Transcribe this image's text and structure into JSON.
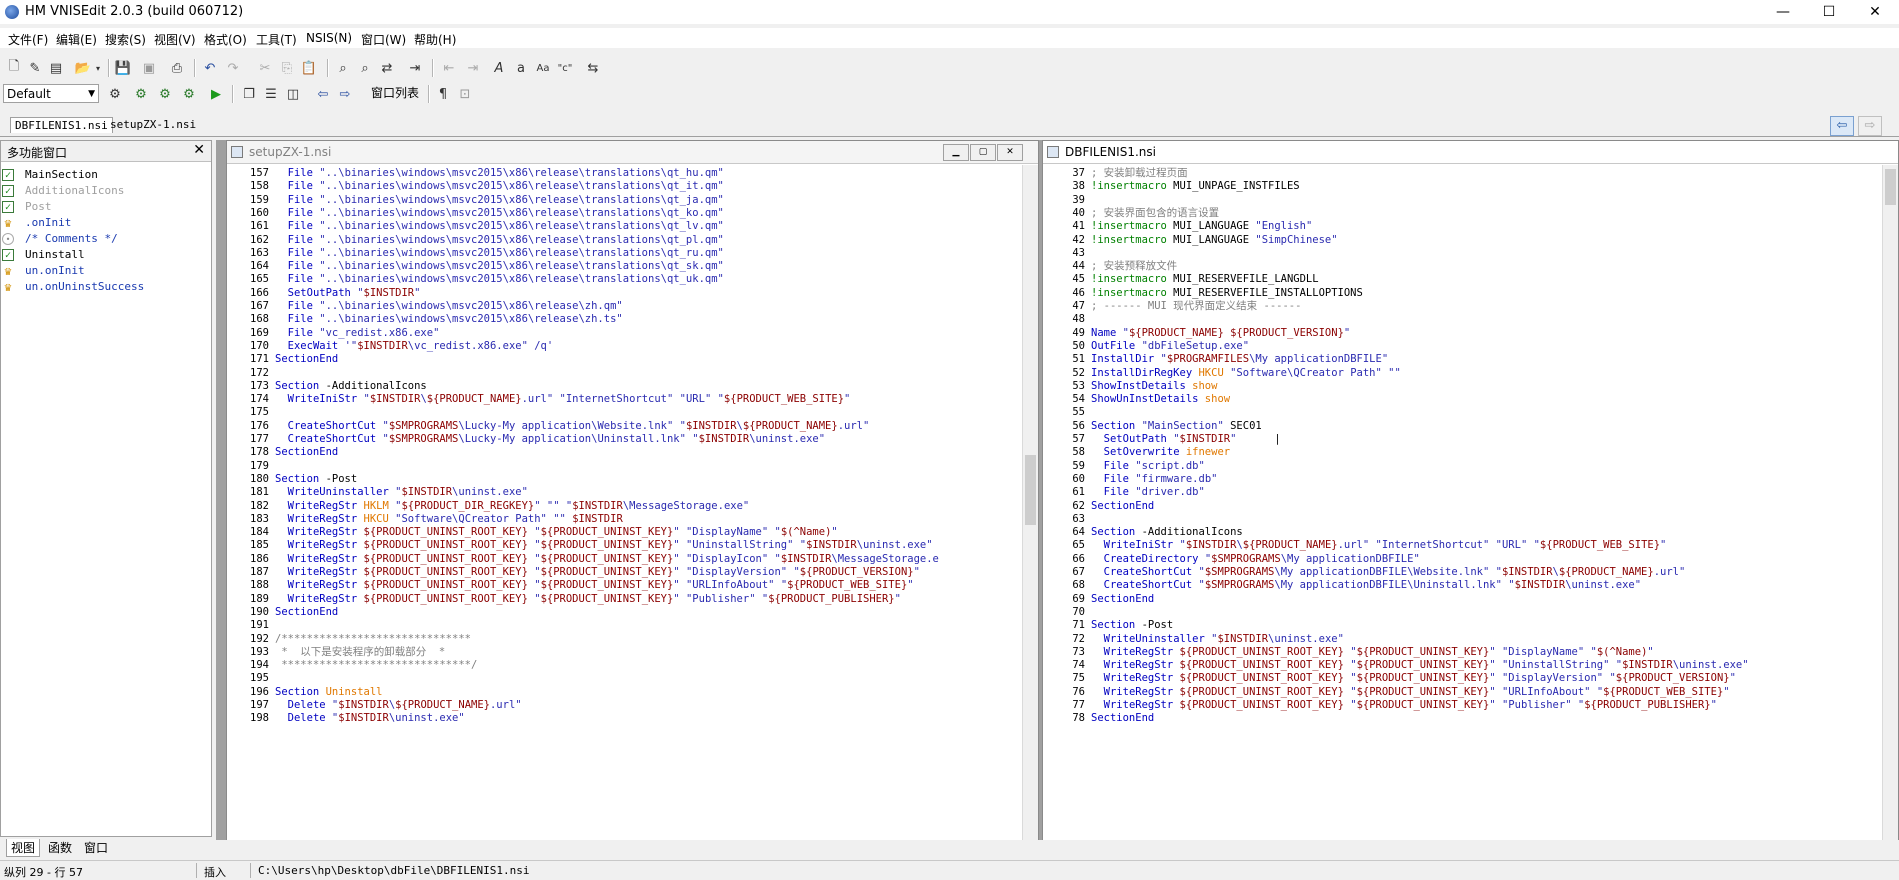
{
  "window": {
    "title": "HM VNISEdit 2.0.3 (build 060712)",
    "minimize": "—",
    "maximize": "☐",
    "close": "✕"
  },
  "menu": [
    "文件(F)",
    "编辑(E)",
    "搜索(S)",
    "视图(V)",
    "格式(O)",
    "工具(T)",
    "NSIS(N)",
    "窗口(W)",
    "帮助(H)"
  ],
  "toolbar2": {
    "combo_value": "Default",
    "window_list": "窗口列表"
  },
  "doc_tabs": [
    "DBFILENIS1.nsi",
    "setupZX-1.nsi"
  ],
  "side_panel": {
    "title": "多功能窗口",
    "items": [
      {
        "label": "MainSection",
        "icon": "checkbox-checked-icon"
      },
      {
        "label": "AdditionalIcons",
        "icon": "checkbox-checked-dim-icon"
      },
      {
        "label": "Post",
        "icon": "checkbox-checked-dim-icon"
      },
      {
        "label": ".onInit",
        "icon": "function-icon"
      },
      {
        "label": "/* Comments */",
        "icon": "comment-icon"
      },
      {
        "label": "Uninstall",
        "icon": "checkbox-checked-icon"
      },
      {
        "label": "un.onInit",
        "icon": "function-icon"
      },
      {
        "label": "un.onUninstSuccess",
        "icon": "function-icon"
      }
    ],
    "tabs": [
      "视图",
      "函数",
      "窗口"
    ]
  },
  "editor_left": {
    "title": "setupZX-1.nsi",
    "lines": [
      {
        "n": "157",
        "t": "  File \"..\\binaries\\windows\\msvc2015\\x86\\release\\translations\\qt_hu.qm\""
      },
      {
        "n": "158",
        "t": "  File \"..\\binaries\\windows\\msvc2015\\x86\\release\\translations\\qt_it.qm\""
      },
      {
        "n": "159",
        "t": "  File \"..\\binaries\\windows\\msvc2015\\x86\\release\\translations\\qt_ja.qm\""
      },
      {
        "n": "160",
        "t": "  File \"..\\binaries\\windows\\msvc2015\\x86\\release\\translations\\qt_ko.qm\""
      },
      {
        "n": "161",
        "t": "  File \"..\\binaries\\windows\\msvc2015\\x86\\release\\translations\\qt_lv.qm\""
      },
      {
        "n": "162",
        "t": "  File \"..\\binaries\\windows\\msvc2015\\x86\\release\\translations\\qt_pl.qm\""
      },
      {
        "n": "163",
        "t": "  File \"..\\binaries\\windows\\msvc2015\\x86\\release\\translations\\qt_ru.qm\""
      },
      {
        "n": "164",
        "t": "  File \"..\\binaries\\windows\\msvc2015\\x86\\release\\translations\\qt_sk.qm\""
      },
      {
        "n": "165",
        "t": "  File \"..\\binaries\\windows\\msvc2015\\x86\\release\\translations\\qt_uk.qm\""
      },
      {
        "n": "166",
        "t": "  SetOutPath \"$INSTDIR\""
      },
      {
        "n": "167",
        "t": "  File \"..\\binaries\\windows\\msvc2015\\x86\\release\\zh.qm\""
      },
      {
        "n": "168",
        "t": "  File \"..\\binaries\\windows\\msvc2015\\x86\\release\\zh.ts\""
      },
      {
        "n": "169",
        "t": "  File \"vc_redist.x86.exe\""
      },
      {
        "n": "170",
        "t": "  ExecWait '\"$INSTDIR\\vc_redist.x86.exe\" /q'"
      },
      {
        "n": "171",
        "t": "SectionEnd"
      },
      {
        "n": "172",
        "t": ""
      },
      {
        "n": "173",
        "t": "Section -AdditionalIcons"
      },
      {
        "n": "174",
        "t": "  WriteIniStr \"$INSTDIR\\${PRODUCT_NAME}.url\" \"InternetShortcut\" \"URL\" \"${PRODUCT_WEB_SITE}\""
      },
      {
        "n": "175",
        "t": "  "
      },
      {
        "n": "176",
        "t": "  CreateShortCut \"$SMPROGRAMS\\Lucky-My application\\Website.lnk\" \"$INSTDIR\\${PRODUCT_NAME}.url\""
      },
      {
        "n": "177",
        "t": "  CreateShortCut \"$SMPROGRAMS\\Lucky-My application\\Uninstall.lnk\" \"$INSTDIR\\uninst.exe\""
      },
      {
        "n": "178",
        "t": "SectionEnd"
      },
      {
        "n": "179",
        "t": ""
      },
      {
        "n": "180",
        "t": "Section -Post"
      },
      {
        "n": "181",
        "t": "  WriteUninstaller \"$INSTDIR\\uninst.exe\""
      },
      {
        "n": "182",
        "t": "  WriteRegStr HKLM \"${PRODUCT_DIR_REGKEY}\" \"\" \"$INSTDIR\\MessageStorage.exe\""
      },
      {
        "n": "183",
        "t": "  WriteRegStr HKCU \"Software\\QCreator Path\" \"\" $INSTDIR"
      },
      {
        "n": "184",
        "t": "  WriteRegStr ${PRODUCT_UNINST_ROOT_KEY} \"${PRODUCT_UNINST_KEY}\" \"DisplayName\" \"$(^Name)\""
      },
      {
        "n": "185",
        "t": "  WriteRegStr ${PRODUCT_UNINST_ROOT_KEY} \"${PRODUCT_UNINST_KEY}\" \"UninstallString\" \"$INSTDIR\\uninst.exe\""
      },
      {
        "n": "186",
        "t": "  WriteRegStr ${PRODUCT_UNINST_ROOT_KEY} \"${PRODUCT_UNINST_KEY}\" \"DisplayIcon\" \"$INSTDIR\\MessageStorage.e"
      },
      {
        "n": "187",
        "t": "  WriteRegStr ${PRODUCT_UNINST_ROOT_KEY} \"${PRODUCT_UNINST_KEY}\" \"DisplayVersion\" \"${PRODUCT_VERSION}\""
      },
      {
        "n": "188",
        "t": "  WriteRegStr ${PRODUCT_UNINST_ROOT_KEY} \"${PRODUCT_UNINST_KEY}\" \"URLInfoAbout\" \"${PRODUCT_WEB_SITE}\""
      },
      {
        "n": "189",
        "t": "  WriteRegStr ${PRODUCT_UNINST_ROOT_KEY} \"${PRODUCT_UNINST_KEY}\" \"Publisher\" \"${PRODUCT_PUBLISHER}\""
      },
      {
        "n": "190",
        "t": "SectionEnd"
      },
      {
        "n": "191",
        "t": ""
      },
      {
        "n": "192",
        "t": "/******************************"
      },
      {
        "n": "193",
        "t": " *  以下是安装程序的卸载部分  *"
      },
      {
        "n": "194",
        "t": " ******************************/"
      },
      {
        "n": "195",
        "t": ""
      },
      {
        "n": "196",
        "t": "Section Uninstall"
      },
      {
        "n": "197",
        "t": "  Delete \"$INSTDIR\\${PRODUCT_NAME}.url\""
      },
      {
        "n": "198",
        "t": "  Delete \"$INSTDIR\\uninst.exe\""
      }
    ]
  },
  "editor_right": {
    "title": "DBFILENIS1.nsi",
    "lines": [
      {
        "n": "37",
        "t": "; 安装卸载过程页面"
      },
      {
        "n": "38",
        "t": "!insertmacro MUI_UNPAGE_INSTFILES"
      },
      {
        "n": "39",
        "t": ""
      },
      {
        "n": "40",
        "t": "; 安装界面包含的语言设置"
      },
      {
        "n": "41",
        "t": "!insertmacro MUI_LANGUAGE \"English\""
      },
      {
        "n": "42",
        "t": "!insertmacro MUI_LANGUAGE \"SimpChinese\""
      },
      {
        "n": "43",
        "t": ""
      },
      {
        "n": "44",
        "t": "; 安装预释放文件"
      },
      {
        "n": "45",
        "t": "!insertmacro MUI_RESERVEFILE_LANGDLL"
      },
      {
        "n": "46",
        "t": "!insertmacro MUI_RESERVEFILE_INSTALLOPTIONS"
      },
      {
        "n": "47",
        "t": "; ------ MUI 现代界面定义结束 ------"
      },
      {
        "n": "48",
        "t": ""
      },
      {
        "n": "49",
        "t": "Name \"${PRODUCT_NAME} ${PRODUCT_VERSION}\""
      },
      {
        "n": "50",
        "t": "OutFile \"dbFileSetup.exe\""
      },
      {
        "n": "51",
        "t": "InstallDir \"$PROGRAMFILES\\My applicationDBFILE\""
      },
      {
        "n": "52",
        "t": "InstallDirRegKey HKCU \"Software\\QCreator Path\" \"\""
      },
      {
        "n": "53",
        "t": "ShowInstDetails show"
      },
      {
        "n": "54",
        "t": "ShowUnInstDetails show"
      },
      {
        "n": "55",
        "t": ""
      },
      {
        "n": "56",
        "t": "Section \"MainSection\" SEC01"
      },
      {
        "n": "57",
        "t": "  SetOutPath \"$INSTDIR\"      |"
      },
      {
        "n": "58",
        "t": "  SetOverwrite ifnewer"
      },
      {
        "n": "59",
        "t": "  File \"script.db\""
      },
      {
        "n": "60",
        "t": "  File \"firmware.db\""
      },
      {
        "n": "61",
        "t": "  File \"driver.db\""
      },
      {
        "n": "62",
        "t": "SectionEnd"
      },
      {
        "n": "63",
        "t": ""
      },
      {
        "n": "64",
        "t": "Section -AdditionalIcons"
      },
      {
        "n": "65",
        "t": "  WriteIniStr \"$INSTDIR\\${PRODUCT_NAME}.url\" \"InternetShortcut\" \"URL\" \"${PRODUCT_WEB_SITE}\""
      },
      {
        "n": "66",
        "t": "  CreateDirectory \"$SMPROGRAMS\\My applicationDBFILE\""
      },
      {
        "n": "67",
        "t": "  CreateShortCut \"$SMPROGRAMS\\My applicationDBFILE\\Website.lnk\" \"$INSTDIR\\${PRODUCT_NAME}.url\""
      },
      {
        "n": "68",
        "t": "  CreateShortCut \"$SMPROGRAMS\\My applicationDBFILE\\Uninstall.lnk\" \"$INSTDIR\\uninst.exe\""
      },
      {
        "n": "69",
        "t": "SectionEnd"
      },
      {
        "n": "70",
        "t": ""
      },
      {
        "n": "71",
        "t": "Section -Post"
      },
      {
        "n": "72",
        "t": "  WriteUninstaller \"$INSTDIR\\uninst.exe\""
      },
      {
        "n": "73",
        "t": "  WriteRegStr ${PRODUCT_UNINST_ROOT_KEY} \"${PRODUCT_UNINST_KEY}\" \"DisplayName\" \"$(^Name)\""
      },
      {
        "n": "74",
        "t": "  WriteRegStr ${PRODUCT_UNINST_ROOT_KEY} \"${PRODUCT_UNINST_KEY}\" \"UninstallString\" \"$INSTDIR\\uninst.exe\""
      },
      {
        "n": "75",
        "t": "  WriteRegStr ${PRODUCT_UNINST_ROOT_KEY} \"${PRODUCT_UNINST_KEY}\" \"DisplayVersion\" \"${PRODUCT_VERSION}\""
      },
      {
        "n": "76",
        "t": "  WriteRegStr ${PRODUCT_UNINST_ROOT_KEY} \"${PRODUCT_UNINST_KEY}\" \"URLInfoAbout\" \"${PRODUCT_WEB_SITE}\""
      },
      {
        "n": "77",
        "t": "  WriteRegStr ${PRODUCT_UNINST_ROOT_KEY} \"${PRODUCT_UNINST_KEY}\" \"Publisher\" \"${PRODUCT_PUBLISHER}\""
      },
      {
        "n": "78",
        "t": "SectionEnd"
      }
    ]
  },
  "status": {
    "position": "纵列 29 - 行 57",
    "mode": "插入",
    "path": "C:\\Users\\hp\\Desktop\\dbFile\\DBFILENIS1.nsi"
  },
  "colors": {
    "keyword": "#000080",
    "string": "#2a2ab0",
    "variable": "#8b0000",
    "comment": "#808080",
    "orange": "#e07800",
    "green": "#008000"
  }
}
